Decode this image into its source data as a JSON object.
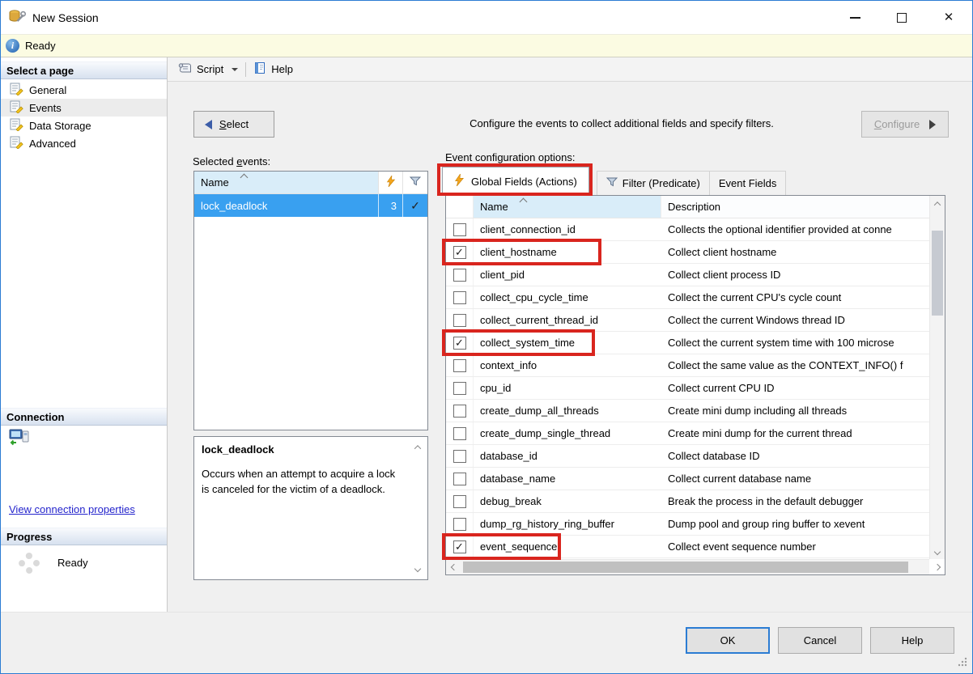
{
  "titlebar": {
    "title": "New Session"
  },
  "statusbar": {
    "text": "Ready"
  },
  "sidebar": {
    "select_page_header": "Select a page",
    "pages": [
      {
        "label": "General",
        "selected": false
      },
      {
        "label": "Events",
        "selected": true
      },
      {
        "label": "Data Storage",
        "selected": false
      },
      {
        "label": "Advanced",
        "selected": false
      }
    ],
    "connection_header": "Connection",
    "connection_link": "View connection properties",
    "progress_header": "Progress",
    "progress_status": "Ready"
  },
  "toolbar": {
    "script": "Script",
    "help": "Help"
  },
  "main": {
    "select_button": {
      "label": "Select",
      "underline_index": 0
    },
    "instruction": "Configure the events to collect additional fields and specify filters.",
    "configure_button": {
      "label": "Configure",
      "underline_index": 0
    },
    "selected_events_label": {
      "label": "Selected events:",
      "underline_index": 9
    },
    "selected_events": {
      "name_header": "Name",
      "rows": [
        {
          "name": "lock_deadlock",
          "actions_count": "3",
          "filtered": true
        }
      ]
    },
    "event_description": {
      "title": "lock_deadlock",
      "text": "Occurs when an attempt to acquire a lock is canceled for the victim of a deadlock."
    },
    "config_label": "Event configuration options:",
    "tabs": [
      {
        "label": "Global Fields (Actions)",
        "icon": "lightning-icon",
        "active": true,
        "annotated": true
      },
      {
        "label": "Filter (Predicate)",
        "icon": "filter-icon",
        "active": false
      },
      {
        "label": "Event Fields",
        "active": false
      }
    ],
    "fields_table": {
      "name_header": "Name",
      "description_header": "Description",
      "rows": [
        {
          "name": "client_connection_id",
          "description": "Collects the optional identifier provided at conne",
          "checked": false,
          "annotated": false
        },
        {
          "name": "client_hostname",
          "description": "Collect client hostname",
          "checked": true,
          "annotated": true
        },
        {
          "name": "client_pid",
          "description": "Collect client process ID",
          "checked": false,
          "annotated": false
        },
        {
          "name": "collect_cpu_cycle_time",
          "description": "Collect the current CPU's cycle count",
          "checked": false,
          "annotated": false
        },
        {
          "name": "collect_current_thread_id",
          "description": "Collect the current Windows thread ID",
          "checked": false,
          "annotated": false
        },
        {
          "name": "collect_system_time",
          "description": "Collect the current system time with 100 microse",
          "checked": true,
          "annotated": true
        },
        {
          "name": "context_info",
          "description": "Collect the same value as the CONTEXT_INFO() f",
          "checked": false,
          "annotated": false
        },
        {
          "name": "cpu_id",
          "description": "Collect current CPU ID",
          "checked": false,
          "annotated": false
        },
        {
          "name": "create_dump_all_threads",
          "description": "Create mini dump including all threads",
          "checked": false,
          "annotated": false
        },
        {
          "name": "create_dump_single_thread",
          "description": "Create mini dump for the current thread",
          "checked": false,
          "annotated": false
        },
        {
          "name": "database_id",
          "description": "Collect database ID",
          "checked": false,
          "annotated": false
        },
        {
          "name": "database_name",
          "description": "Collect current database name",
          "checked": false,
          "annotated": false
        },
        {
          "name": "debug_break",
          "description": "Break the process in the default debugger",
          "checked": false,
          "annotated": false
        },
        {
          "name": "dump_rg_history_ring_buffer",
          "description": "Dump pool and group ring buffer to xevent",
          "checked": false,
          "annotated": false
        },
        {
          "name": "event_sequence",
          "description": "Collect event sequence number",
          "checked": true,
          "annotated": true
        }
      ]
    }
  },
  "footer": {
    "ok": "OK",
    "cancel": "Cancel",
    "help": "Help"
  },
  "icons": {
    "check": "✓",
    "close": "✕",
    "minimize": "–",
    "maximize": "□",
    "info": "i",
    "sort_ascending": "^",
    "dropdown_caret": "▼"
  },
  "colors": {
    "accent": "#2b7cd3",
    "selection": "#39a0f0",
    "column_header_blue": "#d9edf9",
    "annotation_red": "#d9251e",
    "status_yellow": "#fbfbe2",
    "link_blue": "#2424cc"
  }
}
